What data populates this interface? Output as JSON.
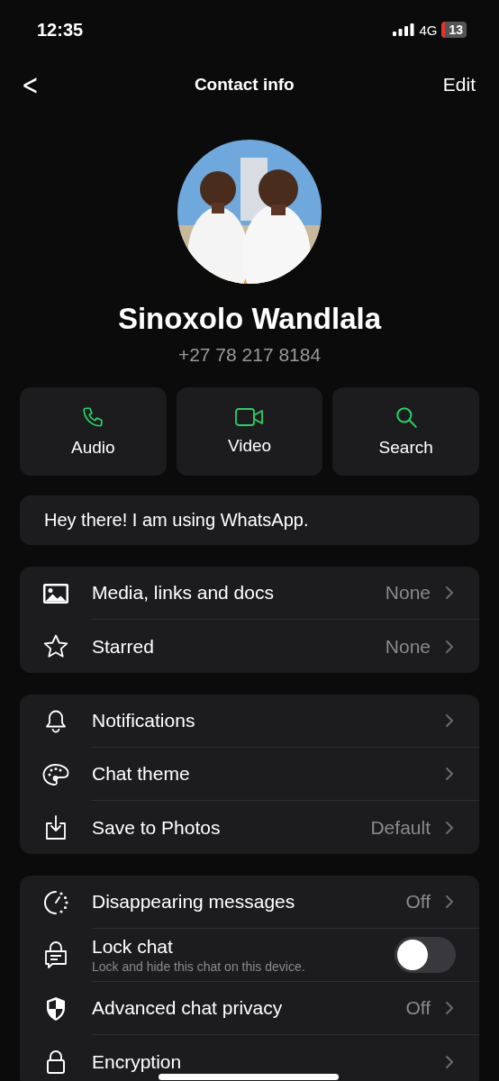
{
  "status_bar": {
    "time": "12:35",
    "network": "4G",
    "battery": "13"
  },
  "nav": {
    "back": "<",
    "title": "Contact info",
    "action": "Edit"
  },
  "profile": {
    "name": "Sinoxolo Wandlala",
    "phone": "+27 78 217 8184"
  },
  "actions": [
    {
      "label": "Audio"
    },
    {
      "label": "Video"
    },
    {
      "label": "Search"
    }
  ],
  "about": "Hey there! I am using WhatsApp.",
  "groups": [
    {
      "rows": [
        {
          "kind": "nav",
          "label": "Media, links and docs",
          "value": "None"
        },
        {
          "kind": "nav",
          "label": "Starred",
          "value": "None"
        }
      ]
    },
    {
      "rows": [
        {
          "kind": "nav",
          "label": "Notifications"
        },
        {
          "kind": "nav",
          "label": "Chat theme"
        },
        {
          "kind": "nav",
          "label": "Save to Photos",
          "value": "Default"
        }
      ]
    },
    {
      "rows": [
        {
          "kind": "nav",
          "label": "Disappearing messages",
          "value": "Off"
        },
        {
          "kind": "toggle",
          "label": "Lock chat",
          "subtitle": "Lock and hide this chat on this device.",
          "on": false
        },
        {
          "kind": "nav",
          "label": "Advanced chat privacy",
          "value": "Off"
        },
        {
          "kind": "nav",
          "label": "Encryption"
        }
      ]
    }
  ]
}
